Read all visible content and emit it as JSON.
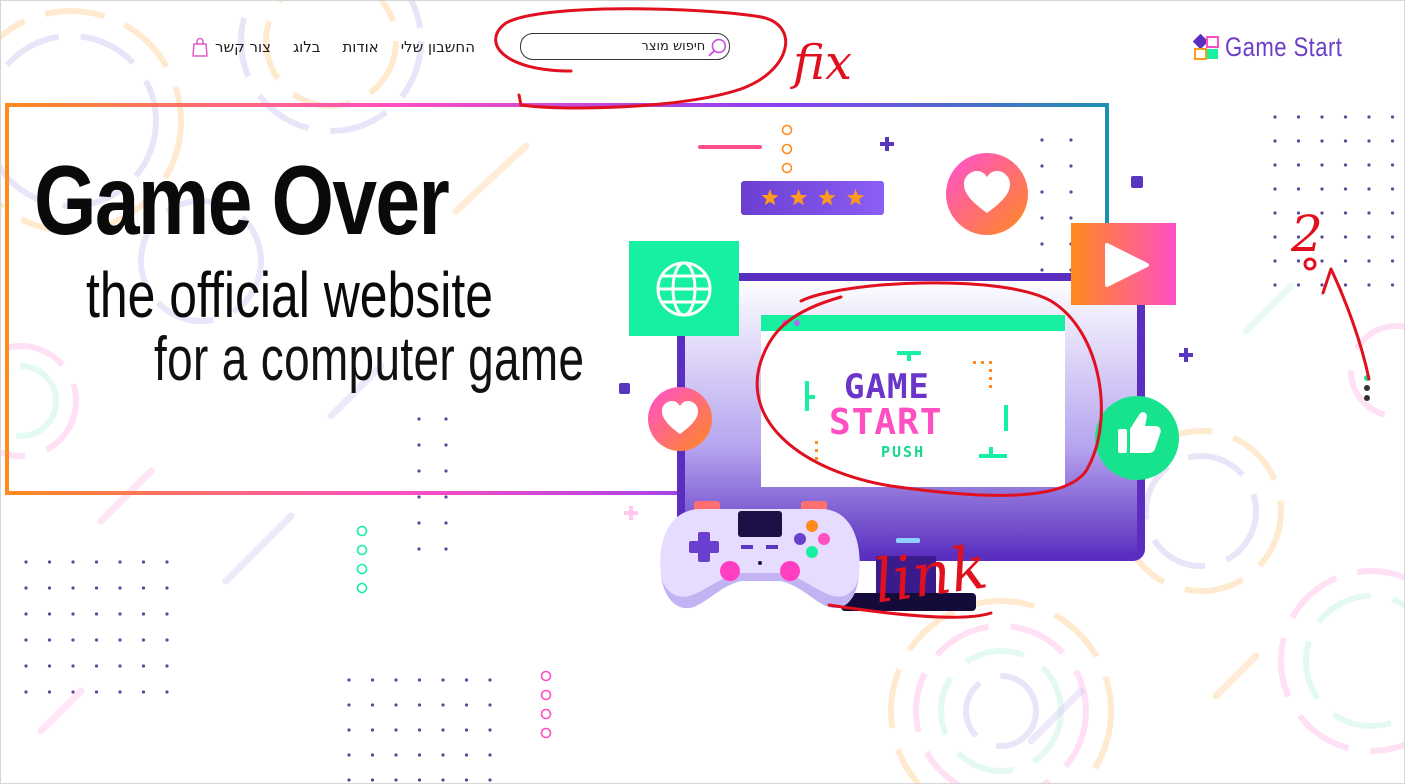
{
  "nav": {
    "items": [
      {
        "label": "החשבון שלי"
      },
      {
        "label": "אודות"
      },
      {
        "label": "בלוג"
      },
      {
        "label": "צור קשר"
      }
    ],
    "cart_icon": "shopping-bag-icon"
  },
  "search": {
    "placeholder": "חיפוש מוצר",
    "icon": "search-icon"
  },
  "logo": {
    "text": "Game Start",
    "icon": "colored-squares-logo-icon"
  },
  "hero": {
    "title": "Game Over",
    "subtitle": "the official website",
    "subtitle2": "for a computer game"
  },
  "illustration": {
    "screen_line1": "GAME",
    "screen_line2": "START",
    "screen_line3": "PUSH",
    "rating_stars": 4,
    "icons": [
      "globe-icon",
      "heart-icon",
      "play-icon",
      "thumbs-up-icon",
      "gamepad-icon"
    ]
  },
  "annotations": {
    "fix": "fix",
    "link": "link",
    "two": "2"
  },
  "colors": {
    "purple": "#6d3fc7",
    "pink": "#ff4fc2",
    "green": "#16f0a0",
    "orange": "#ff8a1e",
    "red_annotation": "#e0101f"
  }
}
